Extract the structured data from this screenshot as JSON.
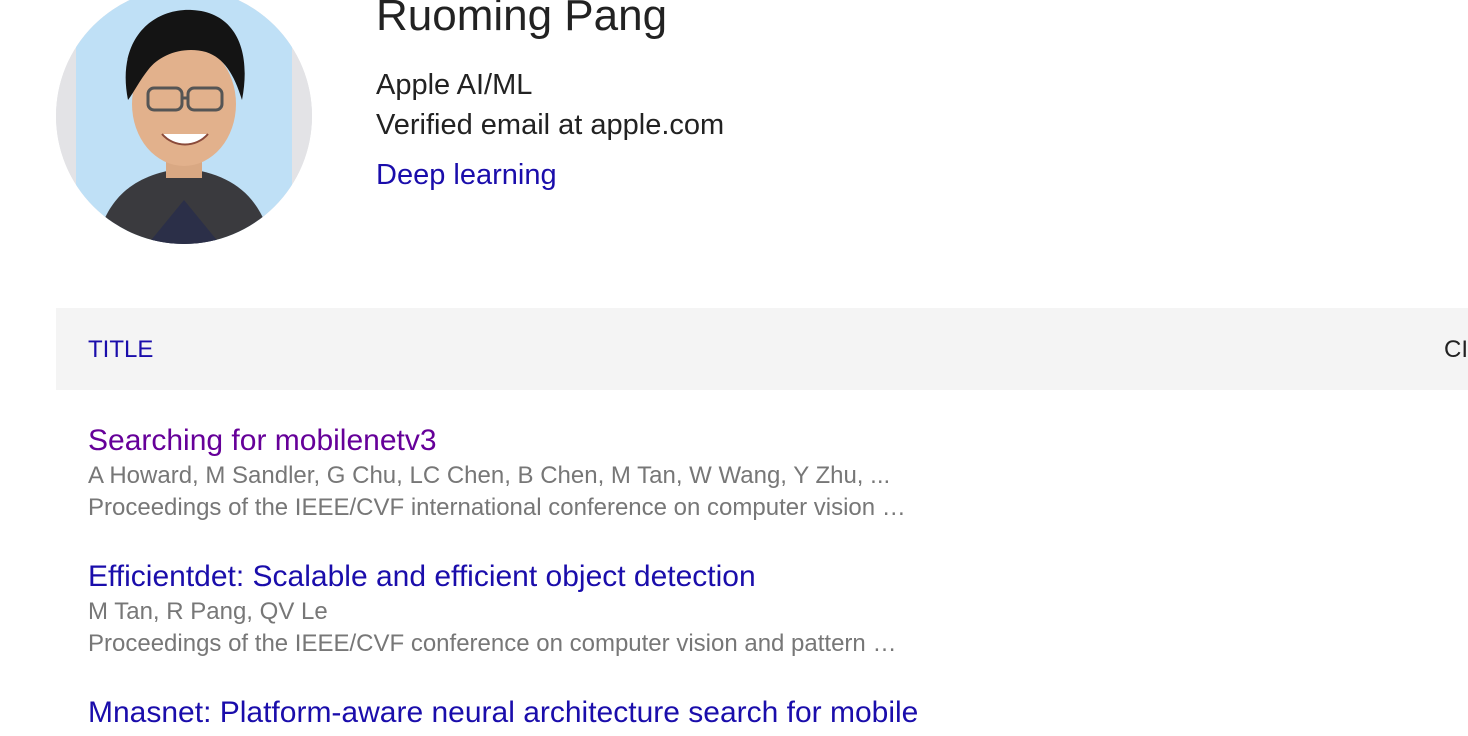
{
  "profile": {
    "name": "Ruoming Pang",
    "affiliation": "Apple AI/ML",
    "email": "Verified email at apple.com",
    "interests": [
      "Deep learning"
    ]
  },
  "table": {
    "headers": {
      "title": "TITLE",
      "cited": "CI"
    },
    "articles": [
      {
        "title": "Searching for mobilenetv3",
        "authors": "A Howard, M Sandler, G Chu, LC Chen, B Chen, M Tan, W Wang, Y Zhu, ...",
        "venue": "Proceedings of the IEEE/CVF international conference on computer vision …",
        "visited": true
      },
      {
        "title": "Efficientdet: Scalable and efficient object detection",
        "authors": "M Tan, R Pang, QV Le",
        "venue": "Proceedings of the IEEE/CVF conference on computer vision and pattern …",
        "visited": false
      },
      {
        "title": "Mnasnet: Platform-aware neural architecture search for mobile",
        "authors": "",
        "venue": "",
        "visited": false
      }
    ]
  },
  "colors": {
    "link": "#1a0dab",
    "visited_link": "#660099",
    "text": "#222222",
    "secondary_text": "#777777",
    "header_bg": "#f4f4f4"
  },
  "icons": {
    "avatar": "profile-photo"
  }
}
